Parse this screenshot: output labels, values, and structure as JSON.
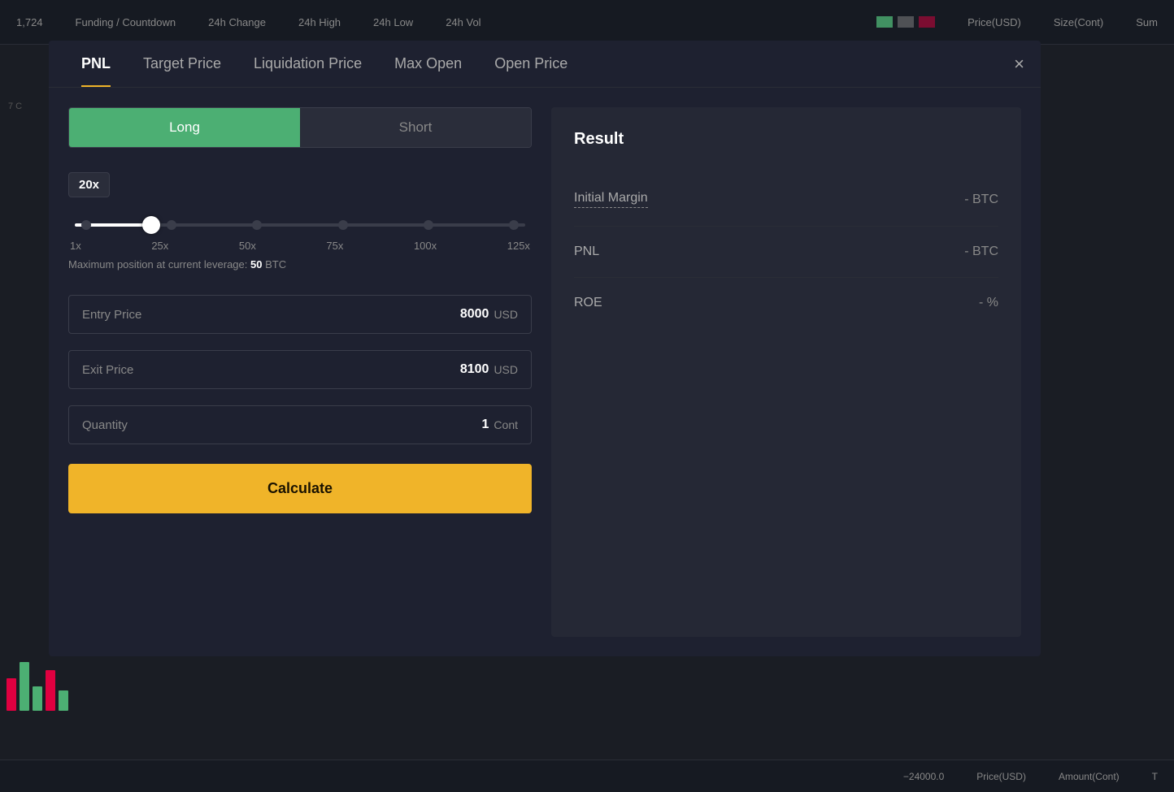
{
  "topBar": {
    "items": [
      "Funding / Countdown",
      "24h Change",
      "24h High",
      "24h Low",
      "24h Vol"
    ],
    "priceLabel": "Price(USD)",
    "sizeLabel": "Size(Cont)",
    "sumLabel": "Sum"
  },
  "modal": {
    "tabs": [
      {
        "id": "pnl",
        "label": "PNL",
        "active": true
      },
      {
        "id": "target-price",
        "label": "Target Price",
        "active": false
      },
      {
        "id": "liquidation-price",
        "label": "Liquidation Price",
        "active": false
      },
      {
        "id": "max-open",
        "label": "Max Open",
        "active": false
      },
      {
        "id": "open-price",
        "label": "Open Price",
        "active": false
      }
    ],
    "closeLabel": "×",
    "direction": {
      "long": "Long",
      "short": "Short",
      "activeSide": "long"
    },
    "leverageLabel": "20x",
    "sliderMarks": [
      "1x",
      "25x",
      "50x",
      "75x",
      "100x",
      "125x"
    ],
    "maxPositionText": "Maximum position at current leverage:",
    "maxPositionValue": "50",
    "maxPositionUnit": "BTC",
    "fields": [
      {
        "label": "Entry Price",
        "value": "8000",
        "unit": "USD"
      },
      {
        "label": "Exit Price",
        "value": "8100",
        "unit": "USD"
      },
      {
        "label": "Quantity",
        "value": "1",
        "unit": "Cont"
      }
    ],
    "calculateLabel": "Calculate",
    "result": {
      "title": "Result",
      "rows": [
        {
          "label": "Initial Margin",
          "underlined": true,
          "value": "- BTC"
        },
        {
          "label": "PNL",
          "underlined": false,
          "value": "- BTC"
        },
        {
          "label": "ROE",
          "underlined": false,
          "value": "- %"
        }
      ]
    }
  },
  "bottomBar": {
    "negValue": "−24000.0",
    "priceLabel": "Price(USD)",
    "amountLabel": "Amount(Cont)",
    "totalLabel": "T"
  },
  "sideNumbers": [
    "7 C"
  ],
  "topNumber": "1,724"
}
